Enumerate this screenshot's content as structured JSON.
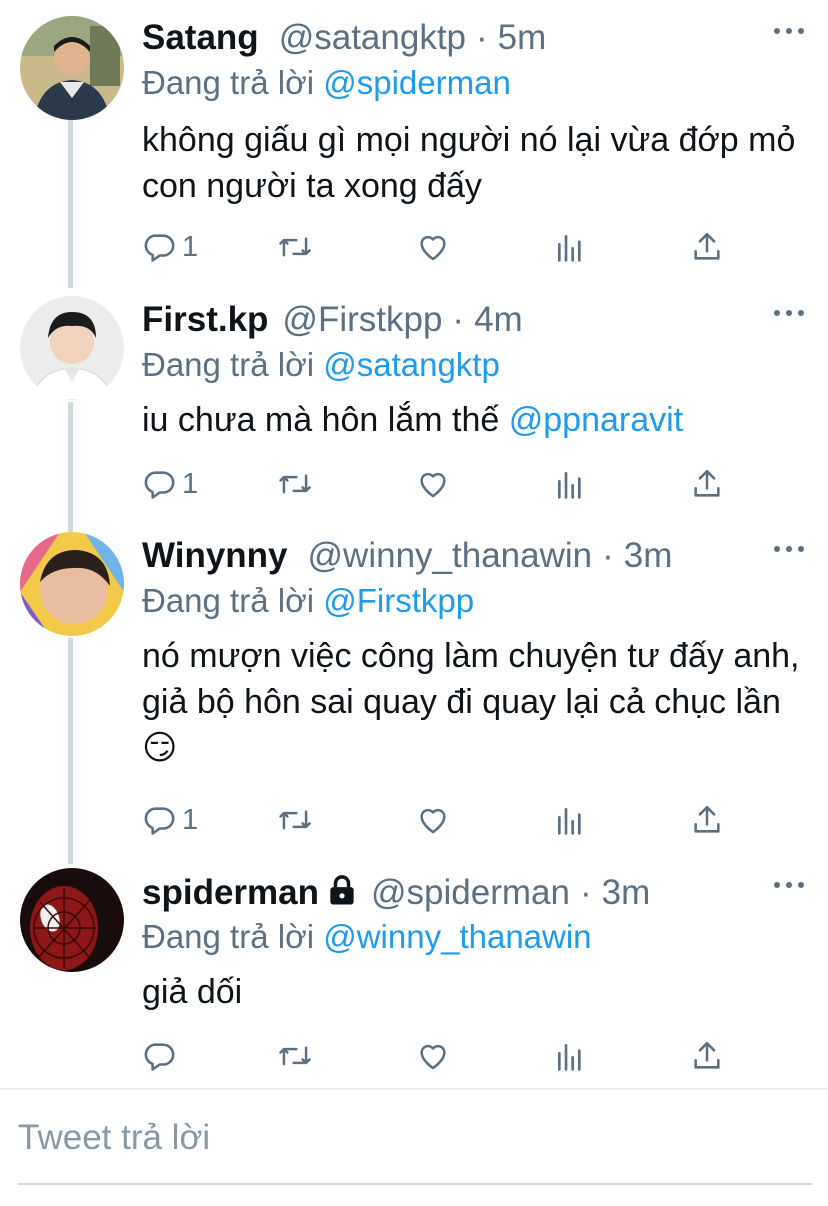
{
  "reply_prefix": "Đang trả lời",
  "tweets": [
    {
      "name": "Satang",
      "handle": "@satangktp",
      "time": "5m",
      "reply_to": "@spiderman",
      "text": "không giấu gì mọi người nó lại vừa đớp mỏ con người ta xong đấy",
      "replies": "1",
      "avatar_icon": "user-avatar"
    },
    {
      "name": "First.kp",
      "handle": "@Firstkpp",
      "time": "4m",
      "reply_to": "@satangktp",
      "text": "iu chưa mà hôn lắm thế ",
      "text_mention": "@ppnaravit",
      "replies": "1",
      "avatar_icon": "user-avatar"
    },
    {
      "name": "Winynny",
      "handle": "@winny_thanawin",
      "time": "3m",
      "reply_to": "@Firstkpp",
      "text": "nó mượn việc công làm chuyện tư đấy anh, giả bộ hôn sai quay đi quay lại cả chục lần 😏",
      "replies": "1",
      "avatar_icon": "user-avatar"
    },
    {
      "name": "spiderman",
      "handle": "@spiderman",
      "time": "3m",
      "reply_to": "@winny_thanawin",
      "text": "giả dối",
      "replies": "",
      "protected": true,
      "avatar_icon": "user-avatar"
    }
  ],
  "icons": {
    "reply": "reply-icon",
    "retweet": "retweet-icon",
    "like": "heart-icon",
    "analytics": "analytics-icon",
    "share": "share-icon",
    "more": "more-icon",
    "lock": "lock-icon"
  },
  "compose": {
    "placeholder": "Tweet trả lời"
  },
  "colors": {
    "link": "#1d9bf0",
    "secondary_text": "#5b7083",
    "thread_line": "#cfd9de"
  }
}
